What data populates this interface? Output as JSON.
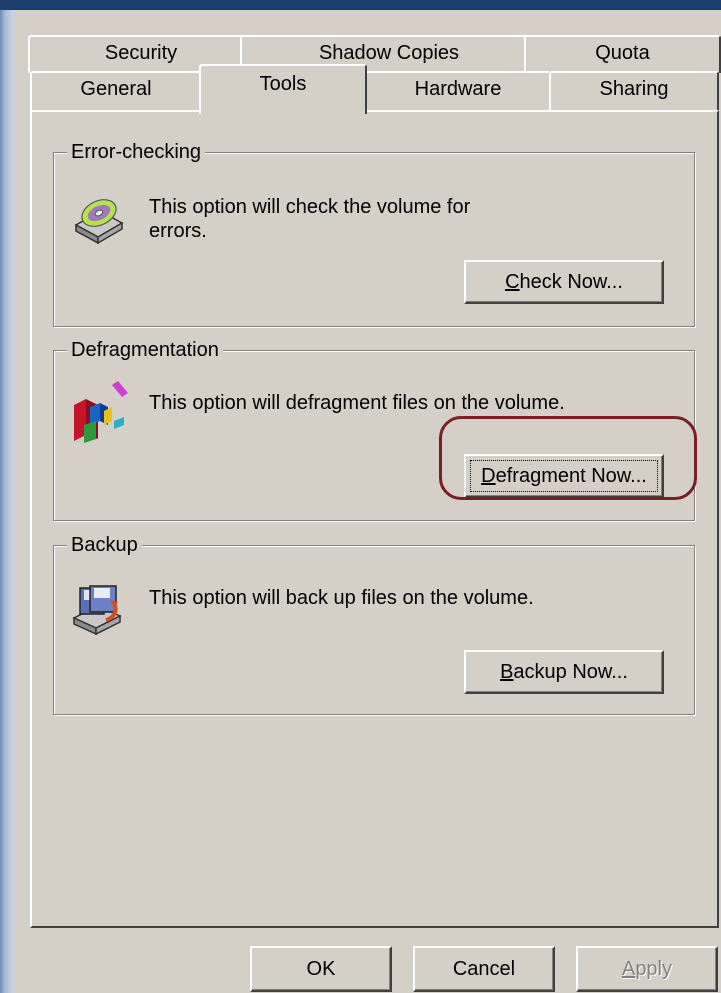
{
  "tabs": {
    "back_row": [
      {
        "label": "Security"
      },
      {
        "label": "Shadow Copies"
      },
      {
        "label": "Quota"
      }
    ],
    "front_row": [
      {
        "label": "General"
      },
      {
        "label": "Tools",
        "selected": true
      },
      {
        "label": "Hardware"
      },
      {
        "label": "Sharing"
      }
    ]
  },
  "error_checking": {
    "title": "Error-checking",
    "description": "This option will check the volume for errors.",
    "icon": "disk-check-icon",
    "button": {
      "pre": "",
      "mnemonic": "C",
      "post": "heck Now..."
    }
  },
  "defragmentation": {
    "title": "Defragmentation",
    "description": "This option will defragment files on the volume.",
    "icon": "defragment-icon",
    "button": {
      "pre": "",
      "mnemonic": "D",
      "post": "efragment Now..."
    },
    "highlight_color": "#7b1f24"
  },
  "backup": {
    "title": "Backup",
    "description": "This option will back up files on the volume.",
    "icon": "backup-icon",
    "button": {
      "pre": "",
      "mnemonic": "B",
      "post": "ackup Now..."
    }
  },
  "footer": {
    "ok_label": "OK",
    "cancel_label": "Cancel",
    "apply": {
      "pre": "",
      "mnemonic": "A",
      "post": "pply",
      "disabled": true
    }
  },
  "colors": {
    "dialog_bg": "#d4d0c8",
    "title_bar": "#1d3c6c"
  }
}
